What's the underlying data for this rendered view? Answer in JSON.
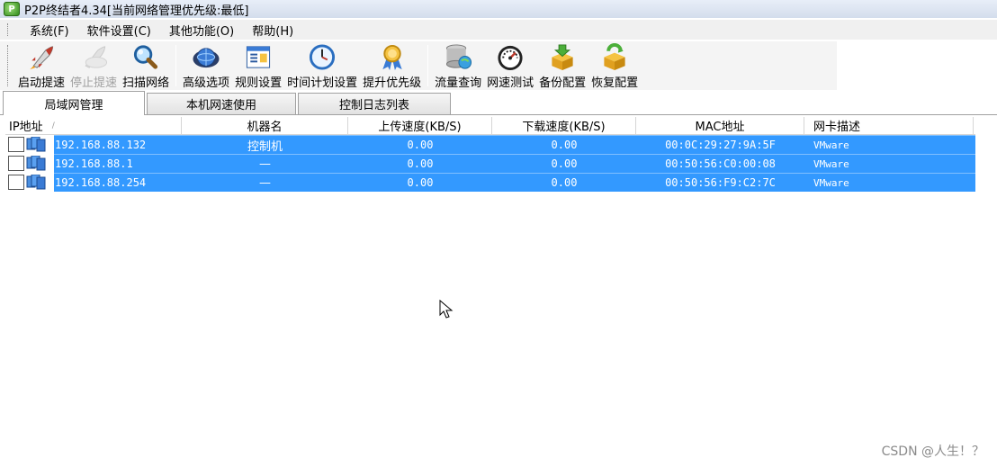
{
  "window": {
    "title": "P2P终结者4.34[当前网络管理优先级:最低]",
    "icon": "p2p-app-icon"
  },
  "menu": [
    {
      "label": "系统(F)"
    },
    {
      "label": "软件设置(C)"
    },
    {
      "label": "其他功能(O)"
    },
    {
      "label": "帮助(H)"
    }
  ],
  "toolbar": {
    "start": {
      "label": "启动提速",
      "icon": "rocket-icon"
    },
    "stop": {
      "label": "停止提速",
      "icon": "rocket-stop-icon"
    },
    "scan": {
      "label": "扫描网络",
      "icon": "magnifier-icon"
    },
    "advanced": {
      "label": "高级选项",
      "icon": "globe-gear-icon"
    },
    "rules": {
      "label": "规则设置",
      "icon": "rules-window-icon"
    },
    "schedule": {
      "label": "时间计划设置",
      "icon": "clock-icon"
    },
    "priority": {
      "label": "提升优先级",
      "icon": "award-ribbon-icon"
    },
    "traffic": {
      "label": "流量查询",
      "icon": "database-globe-icon"
    },
    "speedtest": {
      "label": "网速测试",
      "icon": "speedometer-icon"
    },
    "backup": {
      "label": "备份配置",
      "icon": "box-down-arrow-icon"
    },
    "restore": {
      "label": "恢复配置",
      "icon": "box-recycle-icon"
    }
  },
  "tabs": [
    {
      "label": "局域网管理",
      "active": true
    },
    {
      "label": "本机网速使用",
      "active": false
    },
    {
      "label": "控制日志列表",
      "active": false
    }
  ],
  "table": {
    "columns": [
      "IP地址",
      "机器名",
      "上传速度(KB/S)",
      "下载速度(KB/S)",
      "MAC地址",
      "网卡描述"
    ],
    "sort_indicator": "/",
    "rows": [
      {
        "ip": "192.168.88.132",
        "name": "控制机",
        "up": "0.00",
        "down": "0.00",
        "mac": "00:0C:29:27:9A:5F",
        "desc": "VMware"
      },
      {
        "ip": "192.168.88.1",
        "name": "—",
        "up": "0.00",
        "down": "0.00",
        "mac": "00:50:56:C0:00:08",
        "desc": "VMware"
      },
      {
        "ip": "192.168.88.254",
        "name": "—",
        "up": "0.00",
        "down": "0.00",
        "mac": "00:50:56:F9:C2:7C",
        "desc": "VMware"
      }
    ],
    "selection_color": "#3399ff"
  },
  "watermark": "CSDN @人生！？"
}
